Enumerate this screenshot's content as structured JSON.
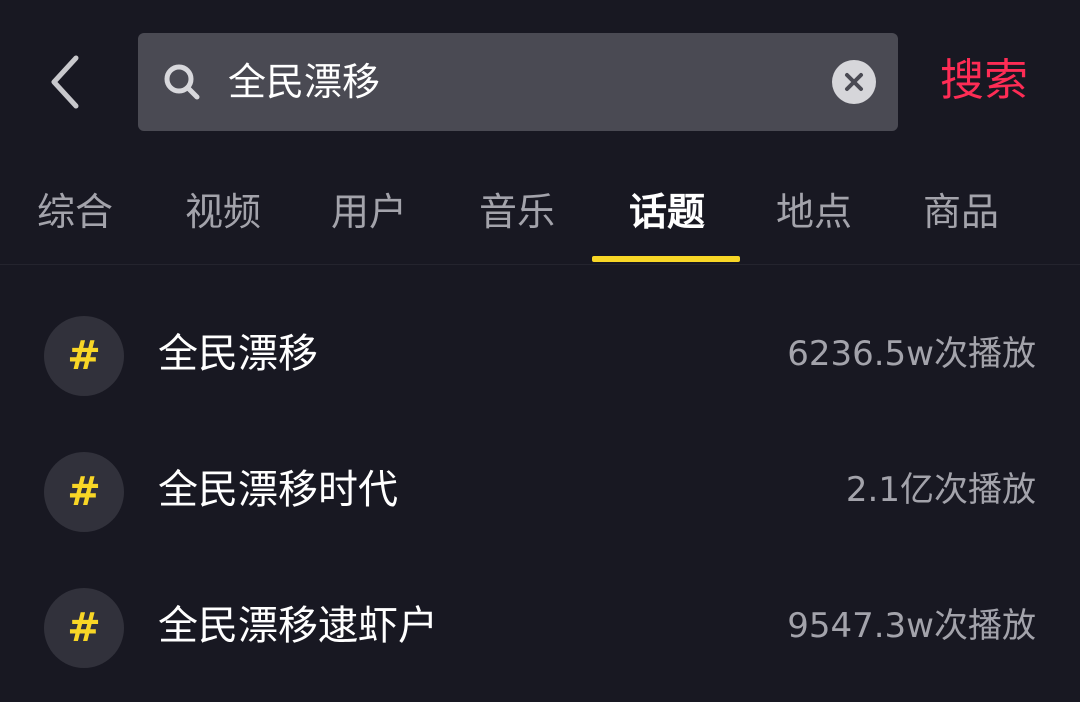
{
  "header": {
    "back_icon": "chevron-left-icon",
    "search_icon": "search-icon",
    "query": "全民漂移",
    "clear_icon": "close-icon",
    "submit_label": "搜索"
  },
  "tabs": [
    {
      "label": "综合",
      "active": false
    },
    {
      "label": "视频",
      "active": false
    },
    {
      "label": "用户",
      "active": false
    },
    {
      "label": "音乐",
      "active": false
    },
    {
      "label": "话题",
      "active": true
    },
    {
      "label": "地点",
      "active": false
    },
    {
      "label": "商品",
      "active": false
    }
  ],
  "results": [
    {
      "icon": "#",
      "title": "全民漂移",
      "count": "6236.5w次播放"
    },
    {
      "icon": "#",
      "title": "全民漂移时代",
      "count": "2.1亿次播放"
    },
    {
      "icon": "#",
      "title": "全民漂移逮虾户",
      "count": "9547.3w次播放"
    }
  ],
  "colors": {
    "background": "#181822",
    "search_box": "#4a4a53",
    "accent_red": "#fe2c55",
    "accent_yellow": "#f8d626",
    "muted_text": "#a3a3ab"
  }
}
